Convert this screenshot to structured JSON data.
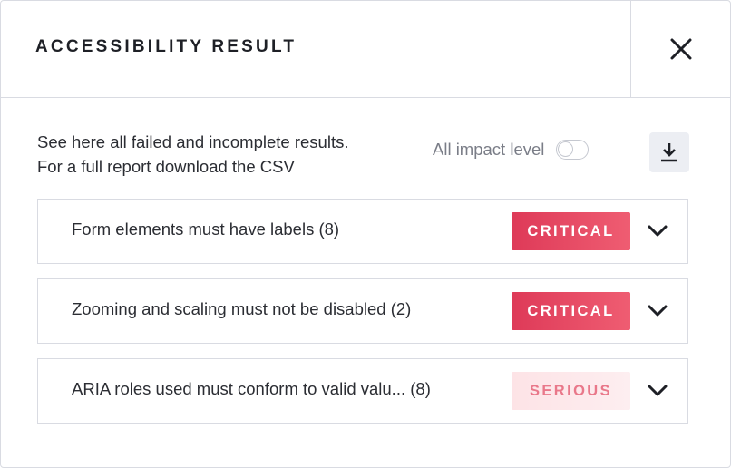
{
  "header": {
    "title": "ACCESSIBILITY RESULT"
  },
  "intro": {
    "line1": "See here all failed and incomplete results.",
    "line2": "For a full report download the CSV"
  },
  "filter": {
    "label": "All impact level",
    "enabled": false
  },
  "icons": {
    "close": "close-icon",
    "download": "download-icon",
    "expand": "chevron-down-icon"
  },
  "results": [
    {
      "label": "Form elements must have labels (8)",
      "impact": "CRITICAL"
    },
    {
      "label": "Zooming and scaling must not be disabled (2)",
      "impact": "CRITICAL"
    },
    {
      "label": "ARIA roles used must conform to valid valu... (8)",
      "impact": "SERIOUS"
    }
  ],
  "colors": {
    "critical": "#e4475f",
    "serious_bg": "#fde7ea",
    "serious_text": "#e9788a",
    "border": "#d9dbe2"
  }
}
